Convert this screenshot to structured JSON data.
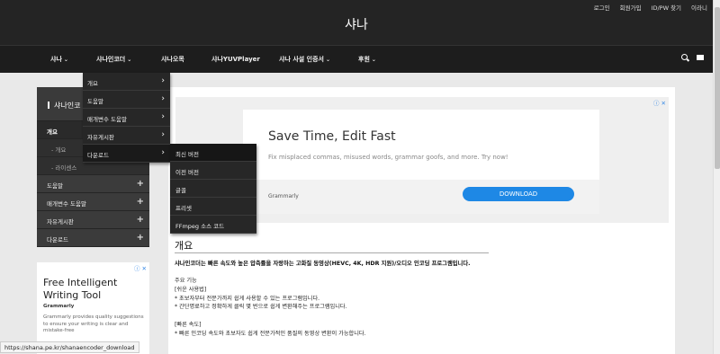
{
  "header": {
    "title": "샤나",
    "top_links": [
      "로그인",
      "회원가입",
      "ID/PW 찾기",
      "이라니"
    ]
  },
  "nav": {
    "items": [
      {
        "label": "샤나",
        "has_caret": true
      },
      {
        "label": "샤나인코더",
        "has_caret": true
      },
      {
        "label": "샤나오목",
        "has_caret": false
      },
      {
        "label": "샤나YUVPlayer",
        "has_caret": false
      },
      {
        "label": "샤나 사설 인증서",
        "has_caret": true
      },
      {
        "label": "후원",
        "has_caret": true
      }
    ],
    "icons": [
      "search-icon",
      "menu-icon"
    ]
  },
  "dropdown_main": {
    "items": [
      "개요",
      "도움말",
      "매개변수 도움말",
      "자유게시판",
      "다운로드"
    ]
  },
  "dropdown_download": {
    "items": [
      "최신 버전",
      "이전 버전",
      "글꼴",
      "프리셋",
      "FFmpeg 소스 코드"
    ]
  },
  "sidebar": {
    "title": "샤나인코",
    "items": [
      {
        "label": "개요",
        "type": "active"
      },
      {
        "label": "- 개요",
        "type": "sub"
      },
      {
        "label": "- 라이센스",
        "type": "sub"
      },
      {
        "label": "도움말",
        "type": "plus"
      },
      {
        "label": "매개변수 도움말",
        "type": "plus"
      },
      {
        "label": "자유게시판",
        "type": "plus"
      },
      {
        "label": "다운로드",
        "type": "plus"
      }
    ]
  },
  "ad_left": {
    "title": "Free Intelligent Writing Tool",
    "brand": "Grammarly",
    "text": "Grammarly provides quality suggestions to ensure your writing is clear and mistake-free"
  },
  "ad_main": {
    "title": "Save Time, Edit Fast",
    "subtitle": "Fix misplaced commas, misused words, grammar goofs, and more. Try now!",
    "brand": "Grammarly",
    "button": "DOWNLOAD"
  },
  "content": {
    "title": "개요",
    "intro": "샤나인코더는 빠른 속도와 높은 압축률을 자랑하는 고화질 동영상(HEVC, 4K, HDR 지원)/오디오 인코딩 프로그램입니다.",
    "lines": [
      "주요 기능",
      "[쉬운 사용법]",
      "* 초보자부터 전문가까지 쉽게 사용할 수 있는 프로그램입니다.",
      "* 간단명료하고 정확하게 클릭 몇 번으로 쉽게 변환해주는 프로그램입니다.",
      "",
      "[빠른 속도]",
      "* 빠른 인코딩 속도와 초보자도 쉽게 전문가적인 품질의 동영상 변환이 가능합니다."
    ]
  },
  "status_bar": {
    "url": "https://shana.pe.kr/shanaencoder_download"
  }
}
